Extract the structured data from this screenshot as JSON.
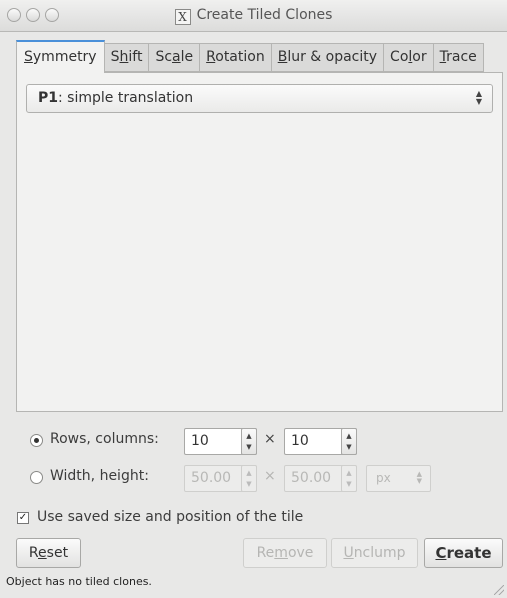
{
  "window": {
    "title": "Create Tiled Clones",
    "app_icon": "x11-icon"
  },
  "tabs": [
    {
      "label": "Symmetry",
      "active": true
    },
    {
      "label": "Shift"
    },
    {
      "label": "Scale"
    },
    {
      "label": "Rotation"
    },
    {
      "label": "Blur & opacity"
    },
    {
      "label": "Color"
    },
    {
      "label": "Trace"
    }
  ],
  "symmetry": {
    "selected_bold": "P1",
    "selected_rest": ": simple translation"
  },
  "rows_columns": {
    "label": "Rows, columns:",
    "rows": "10",
    "columns": "10",
    "selected": true
  },
  "width_height": {
    "label": "Width, height:",
    "width": "50.00",
    "height": "50.00",
    "unit": "px",
    "selected": false
  },
  "times_symbol": "×",
  "use_saved": {
    "label": "Use saved size and position of the tile",
    "checked": true
  },
  "buttons": {
    "reset": "Reset",
    "remove": "Remove",
    "unclump": "Unclump",
    "create": "Create"
  },
  "status": "Object has no tiled clones."
}
